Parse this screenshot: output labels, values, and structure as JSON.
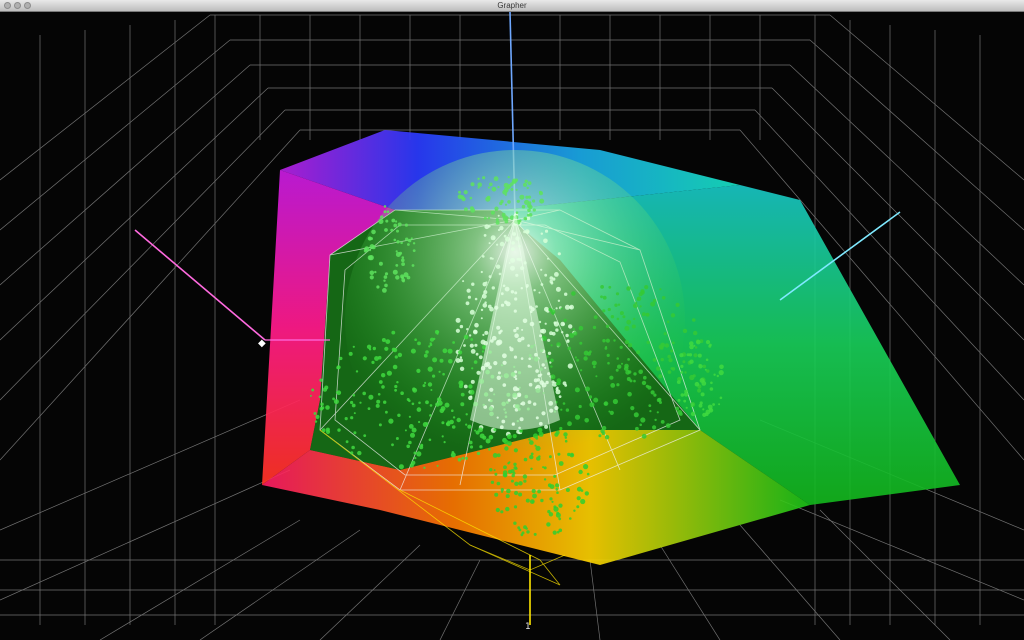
{
  "window": {
    "title": "Grapher",
    "buttons": [
      "close-button",
      "minimize-button",
      "zoom-button"
    ]
  },
  "plot": {
    "type": "3d-color-gamut-plot",
    "z_axis_tick_label": "1",
    "colors": {
      "background": "#050505",
      "grid": "#9a9a9a",
      "axis_blue": "#6fa8ff",
      "axis_magenta": "#ff6adf",
      "axis_cyan": "#7fe9ff",
      "axis_yellow": "#ffe600",
      "points": "#3fd93f"
    }
  }
}
